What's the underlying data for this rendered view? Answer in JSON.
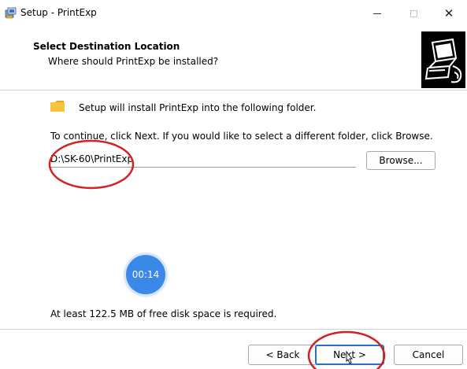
{
  "window": {
    "title": "Setup - PrintExp",
    "close_glyph": "✕"
  },
  "header": {
    "title": "Select Destination Location",
    "subtitle": "Where should PrintExp be installed?"
  },
  "content": {
    "intro": "Setup will install PrintExp into the following folder.",
    "continue_text": "To continue, click Next. If you would like to select a different folder, click Browse.",
    "path_value": "D:\\SK-60\\PrintExp",
    "browse_label": "Browse...",
    "disk_space": "At least 122.5 MB of free disk space is required."
  },
  "overlay": {
    "timer": "00:14"
  },
  "footer": {
    "back_label": "< Back",
    "next_label": "Next >",
    "cancel_label": "Cancel"
  },
  "colors": {
    "annotation_red": "#d42020",
    "timer_blue": "#3a88e8",
    "focus_blue": "#2a6fc9",
    "folder_yellow": "#f5c53d"
  },
  "icons": {
    "title": "setup-installer-icon",
    "header": "computer-install-icon",
    "folder": "folder-icon",
    "minimize": "minimize-icon",
    "maximize": "maximize-icon",
    "close": "close-icon",
    "cursor": "mouse-cursor-icon"
  }
}
